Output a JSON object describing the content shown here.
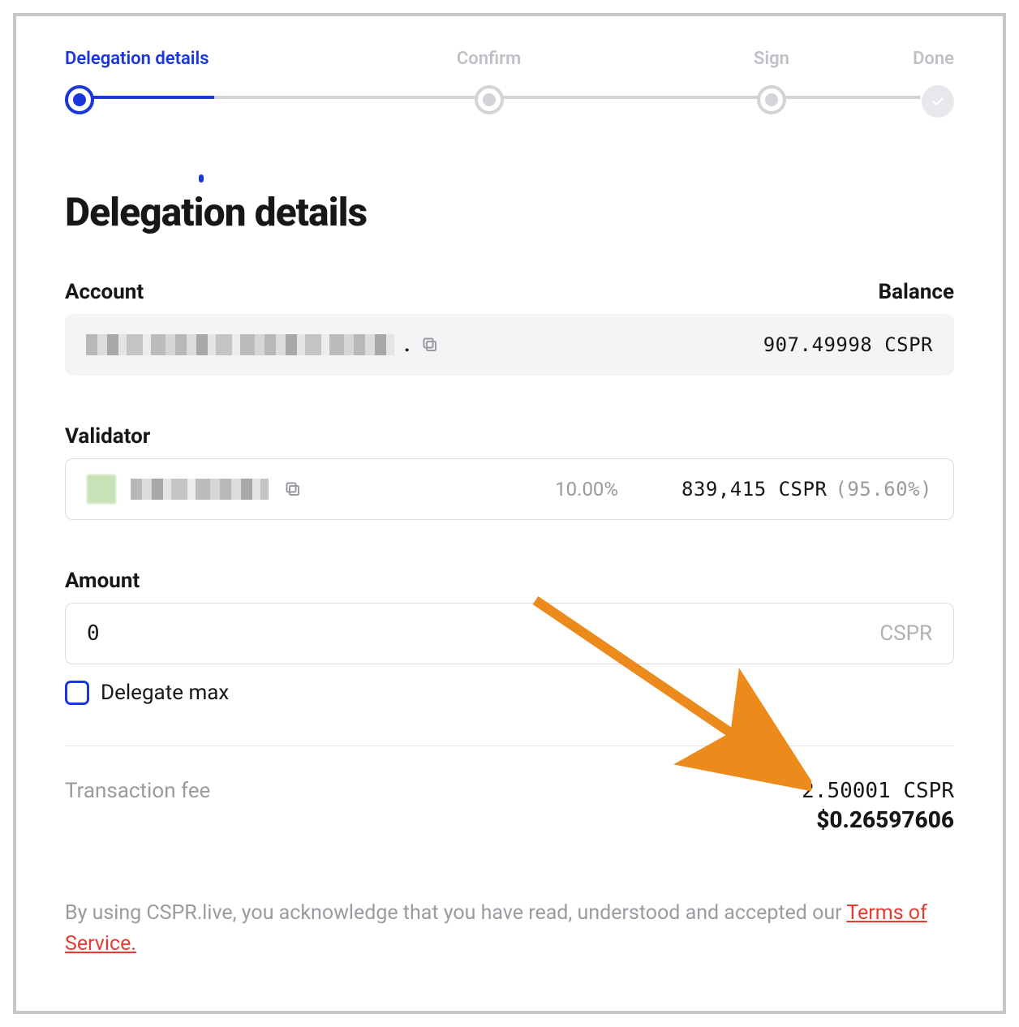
{
  "stepper": {
    "steps": [
      {
        "label": "Delegation details",
        "state": "active"
      },
      {
        "label": "Confirm",
        "state": "pending"
      },
      {
        "label": "Sign",
        "state": "pending"
      },
      {
        "label": "Done",
        "state": "done-icon"
      }
    ]
  },
  "page_title": "Delegation details",
  "account": {
    "label": "Account",
    "balance_label": "Balance",
    "address_redacted": true,
    "balance_value": "907.49998",
    "balance_unit": "CSPR"
  },
  "validator": {
    "label": "Validator",
    "name_redacted": true,
    "fee_pct": "10.00%",
    "stake_amount": "839,415",
    "stake_unit": "CSPR",
    "stake_pct": "(95.60%)"
  },
  "amount": {
    "label": "Amount",
    "value": "0",
    "unit": "CSPR",
    "delegate_max_label": "Delegate max",
    "delegate_max_checked": false
  },
  "transaction_fee": {
    "label": "Transaction fee",
    "cspr_value": "2.50001",
    "cspr_unit": "CSPR",
    "usd_value": "$0.26597606"
  },
  "disclaimer": {
    "text_prefix": "By using CSPR.live, you acknowledge that you have read, understood and accepted our ",
    "tos_label": "Terms of Service."
  }
}
